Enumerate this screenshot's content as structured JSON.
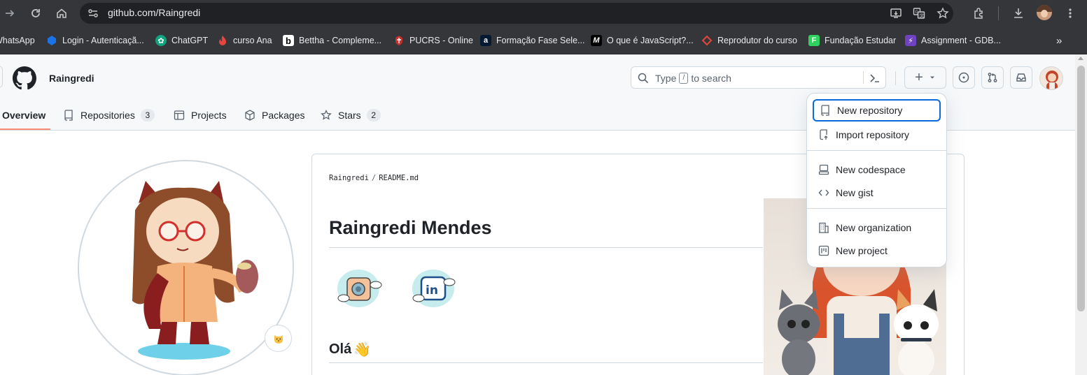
{
  "browser": {
    "url": "github.com/Raingredi",
    "bookmarks": [
      {
        "label": "WhatsApp",
        "icon": "whatsapp-icon",
        "color": "#25d366"
      },
      {
        "label": "Login - Autenticaçã...",
        "icon": "login-icon",
        "color": "#1a73e8"
      },
      {
        "label": "ChatGPT",
        "icon": "chatgpt-icon",
        "color": "#10a37f"
      },
      {
        "label": "curso Ana",
        "icon": "flame-icon",
        "color": "#e8453c"
      },
      {
        "label": "Bettha - Compleme...",
        "icon": "bettha-icon",
        "color": "#ffffff"
      },
      {
        "label": "PUCRS - Online",
        "icon": "pucrs-icon",
        "color": "#c4302b"
      },
      {
        "label": "Formação Fase Sele...",
        "icon": "alura-icon",
        "color": "#051933"
      },
      {
        "label": "O que é JavaScript?...",
        "icon": "mdn-icon",
        "color": "#000000"
      },
      {
        "label": "Reprodutor do curso",
        "icon": "udemy-icon",
        "color": "#e2473c"
      },
      {
        "label": "Fundação Estudar",
        "icon": "estudar-icon",
        "color": "#2ed15d"
      },
      {
        "label": "Assignment - GDB...",
        "icon": "gdb-icon",
        "color": "#6f42c1"
      }
    ],
    "more_bookmarks": "»"
  },
  "github": {
    "username": "Raingredi",
    "search": {
      "prefix": "Type",
      "key": "/",
      "suffix": "to search"
    },
    "tabs": [
      {
        "label": "Overview",
        "icon": "book-icon",
        "counter": null
      },
      {
        "label": "Repositories",
        "icon": "repo-icon",
        "counter": "3"
      },
      {
        "label": "Projects",
        "icon": "table-icon",
        "counter": null
      },
      {
        "label": "Packages",
        "icon": "package-icon",
        "counter": null
      },
      {
        "label": "Stars",
        "icon": "star-icon",
        "counter": "2"
      }
    ],
    "plus_button": "+"
  },
  "create_menu": {
    "items": [
      {
        "label": "New repository",
        "icon": "repo-icon",
        "focused": true
      },
      {
        "label": "Import repository",
        "icon": "repo-push-icon"
      },
      {
        "label": "New codespace",
        "icon": "codespaces-icon"
      },
      {
        "label": "New gist",
        "icon": "code-icon"
      },
      {
        "label": "New organization",
        "icon": "organization-icon"
      },
      {
        "label": "New project",
        "icon": "project-icon"
      }
    ]
  },
  "readme": {
    "path_user": "Raingredi",
    "path_separator": "/",
    "path_file": "README.md",
    "title": "Raingredi Mendes",
    "greeting": "Olá",
    "greeting_emoji": "👋"
  },
  "colors": {
    "tab_underline": "#fd8c73",
    "focus_ring": "#0969da"
  }
}
